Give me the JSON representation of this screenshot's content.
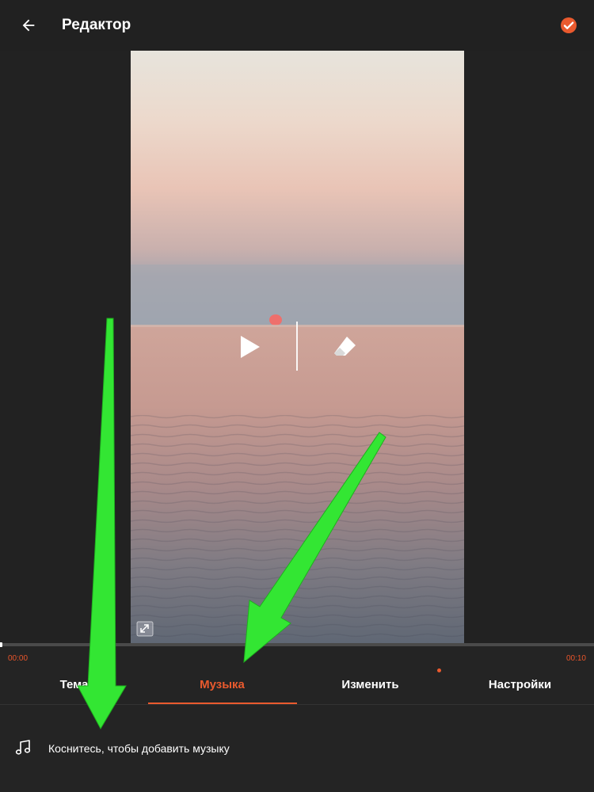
{
  "header": {
    "title": "Редактор",
    "back_icon": "arrow-left-icon",
    "confirm_icon": "check-circle-icon"
  },
  "preview": {
    "play_icon": "play-icon",
    "edit_icon": "eraser-icon",
    "fullscreen_icon": "expand-icon"
  },
  "timeline": {
    "start_time": "00:00",
    "end_time": "00:10",
    "progress": 0
  },
  "tabs": [
    {
      "label": "Тема",
      "active": false
    },
    {
      "label": "Музыка",
      "active": true
    },
    {
      "label": "Изменить",
      "active": false,
      "badge": true
    },
    {
      "label": "Настройки",
      "active": false
    }
  ],
  "music": {
    "add_label": "Коснитесь, чтобы добавить музыку",
    "icon": "music-note-icon"
  },
  "colors": {
    "accent": "#ea5a2e",
    "background": "#242424",
    "annotation_arrow": "#33e633"
  }
}
